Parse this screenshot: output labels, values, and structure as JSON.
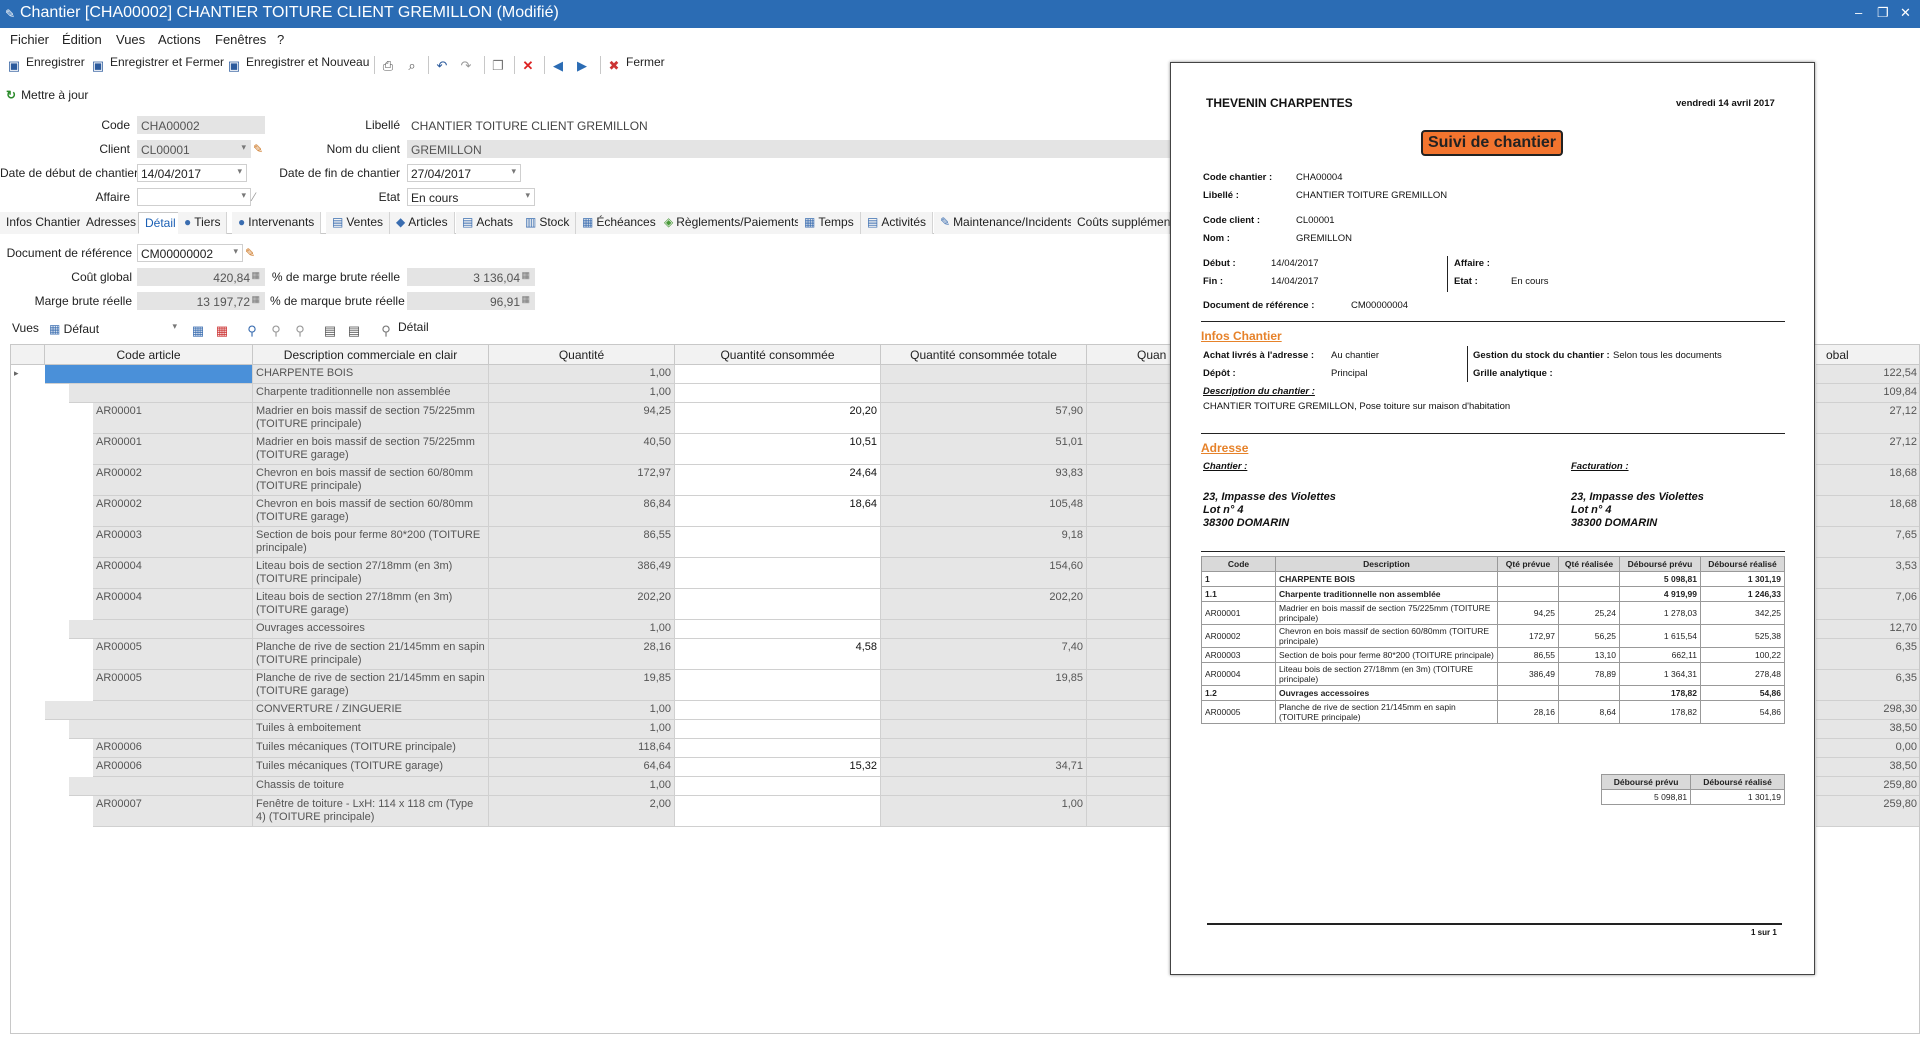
{
  "window": {
    "title": "Chantier [CHA00002] CHANTIER TOITURE CLIENT GREMILLON (Modifié)",
    "minimize": "–",
    "restore": "❐",
    "close": "✕"
  },
  "menu": [
    "Fichier",
    "Édition",
    "Vues",
    "Actions",
    "Fenêtres",
    "?"
  ],
  "toolbar": {
    "save": "Enregistrer",
    "save_close": "Enregistrer et Fermer",
    "save_new": "Enregistrer et Nouveau",
    "close": "Fermer",
    "update": "Mettre à jour"
  },
  "form": {
    "code_label": "Code",
    "code": "CHA00002",
    "libelle_label": "Libellé",
    "libelle": "CHANTIER TOITURE CLIENT GREMILLON",
    "client_label": "Client",
    "client": "CL00001",
    "nom_label": "Nom du client",
    "nom": "GREMILLON",
    "debut_label": "Date de début de chantier",
    "debut": "14/04/2017",
    "fin_label": "Date de fin de chantier",
    "fin": "27/04/2017",
    "affaire_label": "Affaire",
    "affaire": "",
    "etat_label": "Etat",
    "etat": "En cours"
  },
  "tabs": [
    "Infos Chantier",
    "Adresses",
    "Détail",
    "Tiers",
    "Intervenants",
    "Ventes",
    "Articles",
    "Achats",
    "Stock",
    "Échéances",
    "Règlements/Paiements",
    "Temps",
    "Activités",
    "Maintenance/Incidents",
    "Coûts supplémenta"
  ],
  "detail": {
    "docref_label": "Document de référence",
    "docref": "CM00000002",
    "cout_label": "Coût global",
    "cout": "420,84",
    "marge_label": "Marge brute réelle",
    "marge": "13 197,72",
    "pct_marge_label": "% de marge brute réelle",
    "pct_marge": "3 136,04",
    "pct_marque_label": "% de marque brute réelle",
    "pct_marque": "96,91",
    "vues_label": "Vues",
    "vues": "Défaut",
    "detail_btn": "Détail"
  },
  "grid": {
    "headers": [
      "Code article",
      "Description commerciale en clair",
      "Quantité",
      "Quantité consommée",
      "Quantité consommée totale",
      "Quan",
      "obal"
    ],
    "rows": [
      {
        "code": "",
        "desc": "CHARPENTE BOIS",
        "qte": "1,00",
        "cons": "",
        "tot": "",
        "glob": "122,54",
        "lvl": 0,
        "h": 19
      },
      {
        "code": "",
        "desc": "Charpente traditionnelle non assemblée",
        "qte": "1,00",
        "cons": "",
        "tot": "",
        "glob": "109,84",
        "lvl": 1,
        "h": 19
      },
      {
        "code": "AR00001",
        "desc": "Madrier en bois massif de section 75/225mm (TOITURE principale)",
        "qte": "94,25",
        "cons": "20,20",
        "tot": "57,90",
        "glob": "27,12",
        "lvl": 2,
        "h": 31
      },
      {
        "code": "AR00001",
        "desc": "Madrier en bois massif de section 75/225mm (TOITURE garage)",
        "qte": "40,50",
        "cons": "10,51",
        "tot": "51,01",
        "glob": "27,12",
        "lvl": 2,
        "h": 31
      },
      {
        "code": "AR00002",
        "desc": "Chevron en bois massif de section 60/80mm (TOITURE principale)",
        "qte": "172,97",
        "cons": "24,64",
        "tot": "93,83",
        "glob": "18,68",
        "lvl": 2,
        "h": 31
      },
      {
        "code": "AR00002",
        "desc": "Chevron en bois massif de section 60/80mm (TOITURE garage)",
        "qte": "86,84",
        "cons": "18,64",
        "tot": "105,48",
        "glob": "18,68",
        "lvl": 2,
        "h": 31
      },
      {
        "code": "AR00003",
        "desc": "Section de bois pour ferme 80*200 (TOITURE principale)",
        "qte": "86,55",
        "cons": "",
        "tot": "9,18",
        "glob": "7,65",
        "lvl": 2,
        "h": 31
      },
      {
        "code": "AR00004",
        "desc": "Liteau bois de section 27/18mm (en 3m) (TOITURE principale)",
        "qte": "386,49",
        "cons": "",
        "tot": "154,60",
        "glob": "3,53",
        "lvl": 2,
        "h": 31
      },
      {
        "code": "AR00004",
        "desc": "Liteau bois de section 27/18mm (en 3m) (TOITURE garage)",
        "qte": "202,20",
        "cons": "",
        "tot": "202,20",
        "glob": "7,06",
        "lvl": 2,
        "h": 31
      },
      {
        "code": "",
        "desc": "Ouvrages accessoires",
        "qte": "1,00",
        "cons": "",
        "tot": "",
        "glob": "12,70",
        "lvl": 1,
        "h": 19
      },
      {
        "code": "AR00005",
        "desc": "Planche de rive de section 21/145mm en sapin (TOITURE principale)",
        "qte": "28,16",
        "cons": "4,58",
        "tot": "7,40",
        "glob": "6,35",
        "lvl": 2,
        "h": 31
      },
      {
        "code": "AR00005",
        "desc": "Planche de rive de section 21/145mm en sapin (TOITURE garage)",
        "qte": "19,85",
        "cons": "",
        "tot": "19,85",
        "glob": "6,35",
        "lvl": 2,
        "h": 31
      },
      {
        "code": "",
        "desc": "CONVERTURE / ZINGUERIE",
        "qte": "1,00",
        "cons": "",
        "tot": "",
        "glob": "298,30",
        "lvl": 0,
        "h": 19
      },
      {
        "code": "",
        "desc": "Tuiles à emboitement",
        "qte": "1,00",
        "cons": "",
        "tot": "",
        "glob": "38,50",
        "lvl": 1,
        "h": 19
      },
      {
        "code": "AR00006",
        "desc": "Tuiles mécaniques (TOITURE principale)",
        "qte": "118,64",
        "cons": "",
        "tot": "",
        "glob": "0,00",
        "lvl": 2,
        "h": 19
      },
      {
        "code": "AR00006",
        "desc": "Tuiles mécaniques (TOITURE garage)",
        "qte": "64,64",
        "cons": "15,32",
        "tot": "34,71",
        "glob": "38,50",
        "lvl": 2,
        "h": 19
      },
      {
        "code": "",
        "desc": "Chassis de toiture",
        "qte": "1,00",
        "cons": "",
        "tot": "",
        "glob": "259,80",
        "lvl": 1,
        "h": 19
      },
      {
        "code": "AR00007",
        "desc": "Fenêtre de toiture - LxH: 114 x 118 cm (Type 4) (TOITURE principale)",
        "qte": "2,00",
        "cons": "",
        "tot": "1,00",
        "glob": "259,80",
        "lvl": 2,
        "h": 31
      }
    ]
  },
  "report": {
    "company": "THEVENIN CHARPENTES",
    "date": "vendredi 14 avril 2017",
    "title": "Suivi de chantier",
    "code_chantier_label": "Code chantier :",
    "code_chantier": "CHA00004",
    "libelle_label": "Libellé :",
    "libelle": "CHANTIER TOITURE GREMILLON",
    "code_client_label": "Code client :",
    "code_client": "CL00001",
    "nom_label": "Nom :",
    "nom": "GREMILLON",
    "debut_label": "Début :",
    "debut": "14/04/2017",
    "fin_label": "Fin :",
    "fin": "14/04/2017",
    "affaire_label": "Affaire :",
    "etat_label": "Etat :",
    "etat": "En cours",
    "docref_label": "Document de référence :",
    "docref": "CM00000004",
    "infos_title": "Infos Chantier",
    "achat_label": "Achat livrés à l'adresse :",
    "achat": "Au chantier",
    "depot_label": "Dépôt :",
    "depot": "Principal",
    "gestion_label": "Gestion du stock du chantier :",
    "gestion": "Selon tous les documents",
    "grille_label": "Grille analytique :",
    "desc_label": "Description du chantier :",
    "desc": "CHANTIER TOITURE GREMILLON, Pose toiture sur maison d'habitation",
    "adresse_title": "Adresse",
    "chantier_label": "Chantier :",
    "facturation_label": "Facturation :",
    "addr1": "23, Impasse des Violettes",
    "addr2": "Lot n° 4",
    "addr3": "38300 DOMARIN",
    "table_headers": [
      "Code",
      "Description",
      "Qté prévue",
      "Qté réalisée",
      "Déboursé prévu",
      "Déboursé réalisé"
    ],
    "table_rows": [
      [
        "1",
        "CHARPENTE BOIS",
        "",
        "",
        "5 098,81",
        "1 301,19"
      ],
      [
        "1.1",
        "Charpente traditionnelle non assemblée",
        "",
        "",
        "4 919,99",
        "1 246,33"
      ],
      [
        "AR00001",
        "Madrier en bois massif de section 75/225mm (TOITURE principale)",
        "94,25",
        "25,24",
        "1 278,03",
        "342,25"
      ],
      [
        "AR00002",
        "Chevron en bois massif de section 60/80mm (TOITURE principale)",
        "172,97",
        "56,25",
        "1 615,54",
        "525,38"
      ],
      [
        "AR00003",
        "Section de bois pour ferme 80*200 (TOITURE principale)",
        "86,55",
        "13,10",
        "662,11",
        "100,22"
      ],
      [
        "AR00004",
        "Liteau bois de section 27/18mm (en 3m) (TOITURE principale)",
        "386,49",
        "78,89",
        "1 364,31",
        "278,48"
      ],
      [
        "1.2",
        "Ouvrages accessoires",
        "",
        "",
        "178,82",
        "54,86"
      ],
      [
        "AR00005",
        "Planche de rive de section 21/145mm en sapin (TOITURE principale)",
        "28,16",
        "8,64",
        "178,82",
        "54,86"
      ]
    ],
    "total_headers": [
      "Déboursé prévu",
      "Déboursé réalisé"
    ],
    "total_values": [
      "5 098,81",
      "1 301,19"
    ],
    "page": "1 sur 1"
  }
}
